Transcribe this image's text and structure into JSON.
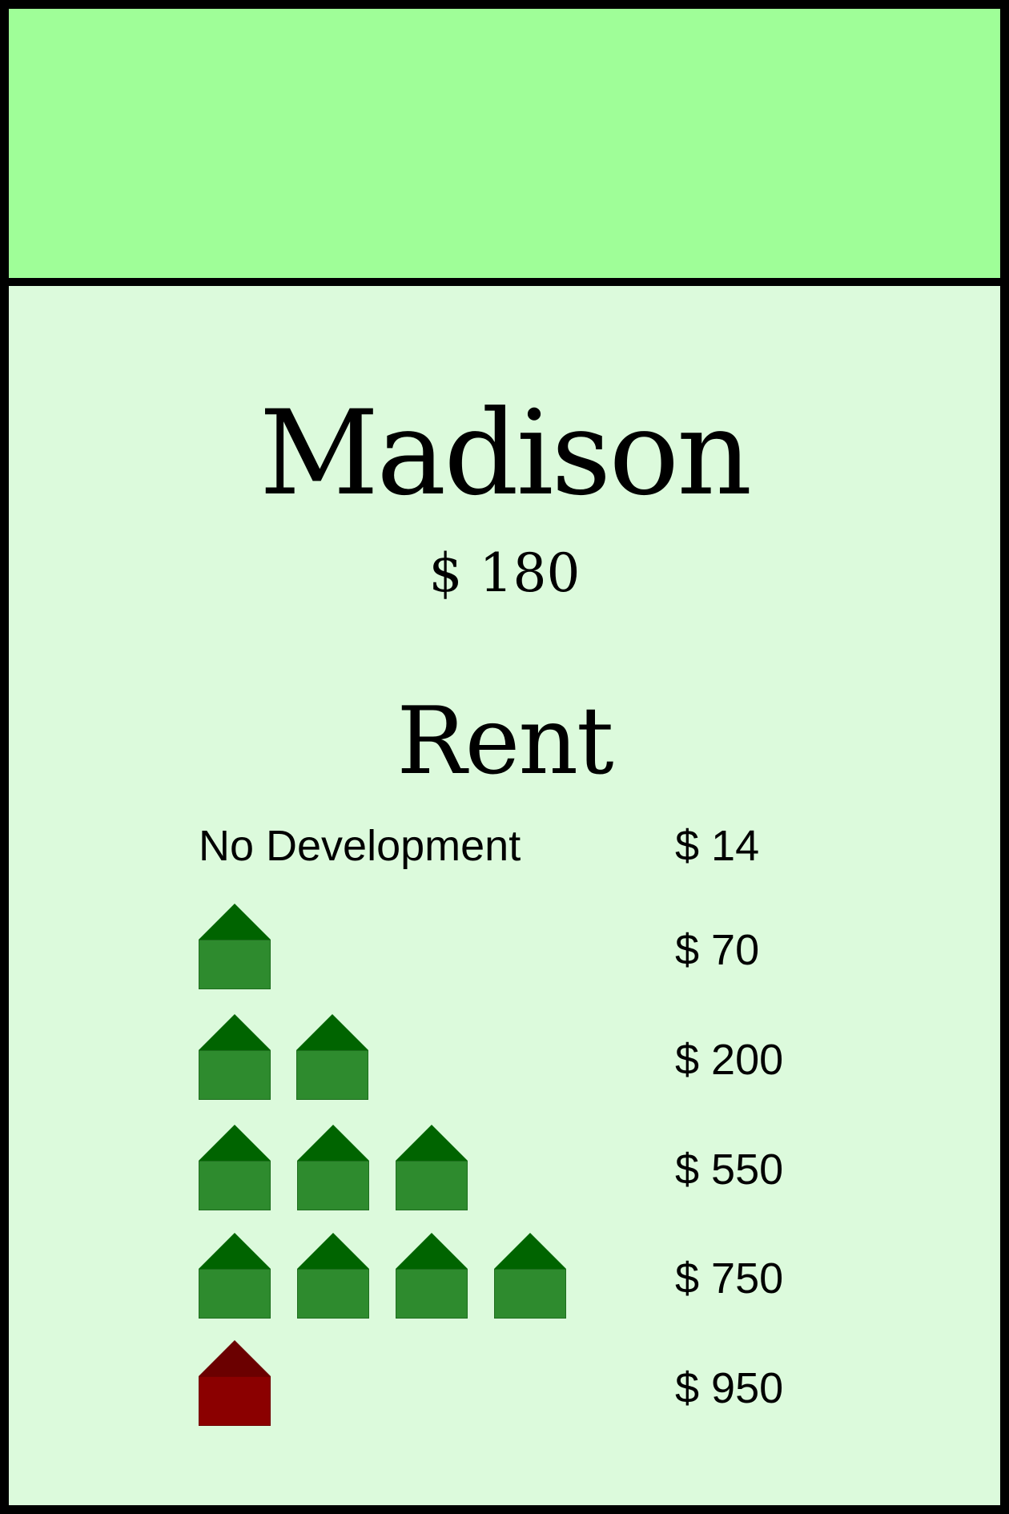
{
  "card": {
    "colors": {
      "band": "#9ffe98",
      "body": "#dcfadc",
      "house": "#2e8b2e",
      "hotel": "#8b0000"
    },
    "name": "Madison",
    "price": "$ 180",
    "rent_heading": "Rent",
    "rents": [
      {
        "label": "No Development",
        "value": "$ 14",
        "houses": 0,
        "hotel": false
      },
      {
        "label": "",
        "value": "$ 70",
        "houses": 1,
        "hotel": false
      },
      {
        "label": "",
        "value": "$ 200",
        "houses": 2,
        "hotel": false
      },
      {
        "label": "",
        "value": "$ 550",
        "houses": 3,
        "hotel": false
      },
      {
        "label": "",
        "value": "$ 750",
        "houses": 4,
        "hotel": false
      },
      {
        "label": "",
        "value": "$ 950",
        "houses": 0,
        "hotel": true
      }
    ]
  }
}
